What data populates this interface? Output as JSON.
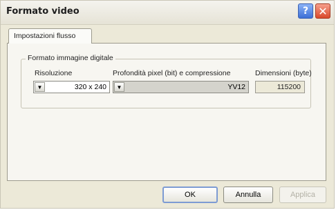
{
  "dialog": {
    "title": "Formato video",
    "help_label": "?",
    "close_label": "✕"
  },
  "tabs": [
    {
      "label": "Impostazioni flusso",
      "active": true
    }
  ],
  "group": {
    "label": "Formato immagine digitale",
    "resolution": {
      "label": "Risoluzione",
      "value": "320 x 240"
    },
    "pixel_depth": {
      "label": "Profondità pixel (bit) e compressione",
      "value": "YV12",
      "disabled": true
    },
    "size": {
      "label": "Dimensioni (byte)",
      "value": "115200"
    }
  },
  "buttons": {
    "ok": "OK",
    "cancel": "Annulla",
    "apply": "Applica"
  },
  "icons": {
    "dropdown": "▼"
  }
}
